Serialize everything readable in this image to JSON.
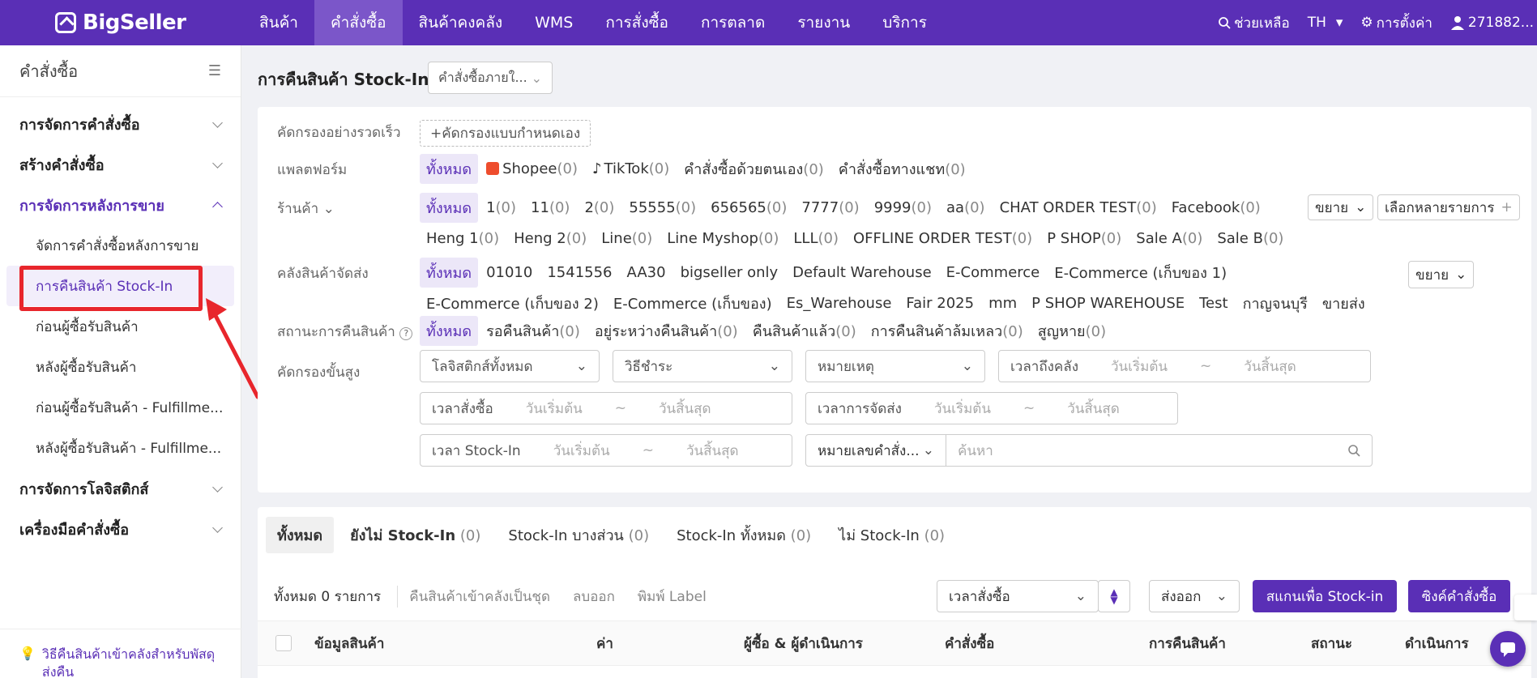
{
  "brand": {
    "name": "BigSeller",
    "accent": "#5a2fb6"
  },
  "topnav": {
    "items": [
      "สินค้า",
      "คำสั่งซื้อ",
      "สินค้าคงคลัง",
      "WMS",
      "การสั่งซื้อ",
      "การตลาด",
      "รายงาน",
      "บริการ"
    ],
    "active_index": 1,
    "help": "ช่วยเหลือ",
    "lang": "TH",
    "settings": "การตั้งค่า",
    "user": "271882..."
  },
  "sidebar": {
    "title": "คำสั่งซื้อ",
    "groups": [
      {
        "label": "การจัดการคำสั่งซื้อ"
      },
      {
        "label": "สร้างคำสั่งซื้อ"
      },
      {
        "label": "การจัดการหลังการขาย"
      }
    ],
    "sub_items": [
      "จัดการคำสั่งซื้อหลังการขาย",
      "การคืนสินค้า Stock-In",
      "ก่อนผู้ซื้อรับสินค้า",
      "หลังผู้ซื้อรับสินค้า",
      "ก่อนผู้ซื้อรับสินค้า - Fulfillme...",
      "หลังผู้ซื้อรับสินค้า - Fulfillme..."
    ],
    "groups_after": [
      {
        "label": "การจัดการโลจิสติกส์"
      },
      {
        "label": "เครื่องมือคำสั่งซื้อ"
      }
    ],
    "footer": "วิธีคืนสินค้าเข้าคลังสำหรับพัสดุส่งคืน"
  },
  "page": {
    "title": "การคืนสินค้า Stock-In",
    "select": "คำสั่งซื้อภายใ..."
  },
  "filters": {
    "quick_label": "คัดกรองอย่างรวดเร็ว",
    "quick_button": "+คัดกรองแบบกำหนดเอง",
    "platform_label": "แพลตฟอร์ม",
    "platforms": [
      {
        "name": "ทั้งหมด",
        "count": ""
      },
      {
        "name": "Shopee",
        "count": "(0)"
      },
      {
        "name": "TikTok",
        "count": "(0)"
      },
      {
        "name": "คำสั่งซื้อด้วยตนเอง",
        "count": "(0)"
      },
      {
        "name": "คำสั่งซื้อทางแชท",
        "count": "(0)"
      }
    ],
    "store_label": "ร้านค้า",
    "stores_row1": [
      {
        "name": "ทั้งหมด",
        "count": ""
      },
      {
        "name": "1",
        "count": "(0)"
      },
      {
        "name": "11",
        "count": "(0)"
      },
      {
        "name": "2",
        "count": "(0)"
      },
      {
        "name": "55555",
        "count": "(0)"
      },
      {
        "name": "656565",
        "count": "(0)"
      },
      {
        "name": "7777",
        "count": "(0)"
      },
      {
        "name": "9999",
        "count": "(0)"
      },
      {
        "name": "aa",
        "count": "(0)"
      },
      {
        "name": "CHAT ORDER TEST",
        "count": "(0)"
      },
      {
        "name": "Facebook",
        "count": "(0)"
      }
    ],
    "stores_row2": [
      {
        "name": "Heng 1",
        "count": "(0)"
      },
      {
        "name": "Heng 2",
        "count": "(0)"
      },
      {
        "name": "Line",
        "count": "(0)"
      },
      {
        "name": "Line Myshop",
        "count": "(0)"
      },
      {
        "name": "LLL",
        "count": "(0)"
      },
      {
        "name": "OFFLINE ORDER TEST",
        "count": "(0)"
      },
      {
        "name": "P SHOP",
        "count": "(0)"
      },
      {
        "name": "Sale A",
        "count": "(0)"
      },
      {
        "name": "Sale B",
        "count": "(0)"
      }
    ],
    "expand": "ขยาย",
    "multi_select": "เลือกหลายรายการ",
    "warehouse_label": "คลังสินค้าจัดส่ง",
    "warehouses_row1": [
      "ทั้งหมด",
      "01010",
      "1541556",
      "AA30",
      "bigseller only",
      "Default Warehouse",
      "E-Commerce",
      "E-Commerce (เก็บของ 1)"
    ],
    "warehouses_row2": [
      "E-Commerce (เก็บของ 2)",
      "E-Commerce (เก็บของ)",
      "Es_Warehouse",
      "Fair 2025",
      "mm",
      "P SHOP WAREHOUSE",
      "Test",
      "กาญจนบุรี",
      "ขายส่ง"
    ],
    "status_label": "สถานะการคืนสินค้า",
    "statuses": [
      {
        "name": "ทั้งหมด",
        "count": ""
      },
      {
        "name": "รอคืนสินค้า",
        "count": "(0)"
      },
      {
        "name": "อยู่ระหว่างคืนสินค้า",
        "count": "(0)"
      },
      {
        "name": "คืนสินค้าแล้ว",
        "count": "(0)"
      },
      {
        "name": "การคืนสินค้าล้มเหลว",
        "count": "(0)"
      },
      {
        "name": "สูญหาย",
        "count": "(0)"
      }
    ],
    "advanced_label": "คัดกรองขั้นสูง",
    "logistics": "โลจิสติกส์ทั้งหมด",
    "payment": "วิธีชำระ",
    "reason": "หมายเหตุ",
    "arrive_time": "เวลาถึงคลัง",
    "order_time": "เวลาสั่งซื้อ",
    "ship_time": "เวลาการจัดส่ง",
    "stockin_time": "เวลา Stock-In",
    "start": "วันเริ่มต้น",
    "end": "วันสิ้นสุด",
    "tilde": "~",
    "search_type": "หมายเลขคำสั่ง...",
    "search_placeholder": "ค้นหา"
  },
  "tabs": [
    {
      "name": "ทั้งหมด",
      "count": ""
    },
    {
      "name": "ยังไม่ Stock-In",
      "count": "(0)"
    },
    {
      "name": "Stock-In บางส่วน",
      "count": "(0)"
    },
    {
      "name": "Stock-In ทั้งหมด",
      "count": "(0)"
    },
    {
      "name": "ไม่ Stock-In",
      "count": "(0)"
    }
  ],
  "toolbar": {
    "total": "ทั้งหมด 0 รายการ",
    "batch": "คืนสินค้าเข้าคลังเป็นชุด",
    "delete": "ลบออก",
    "print": "พิมพ์ Label",
    "sort": "เวลาสั่งซื้อ",
    "export": "ส่งออก",
    "scan": "สแกนเพื่อ Stock-in",
    "sync": "ซิงค์คำสั่งซื้อ"
  },
  "table_headers": [
    "ข้อมูลสินค้า",
    "ค่า",
    "ผู้ซื้อ & ผู้ดำเนินการ",
    "คำสั่งซื้อ",
    "การคืนสินค้า",
    "สถานะ",
    "ดำเนินการ"
  ]
}
